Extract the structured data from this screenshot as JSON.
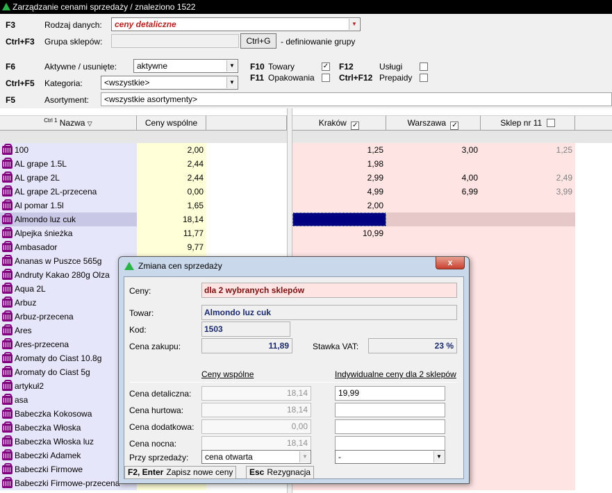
{
  "window": {
    "title": "Zarządzanie cenami sprzedaży / znaleziono 1522"
  },
  "filters": {
    "data_type": {
      "hotkey": "F3",
      "label": "Rodzaj danych:",
      "value": "ceny detaliczne"
    },
    "store_group": {
      "hotkey": "Ctrl+F3",
      "label": "Grupa sklepów:",
      "value": "",
      "button": "Ctrl+G",
      "hint": "- definiowanie grupy"
    },
    "active": {
      "hotkey": "F6",
      "label": "Aktywne / usunięte:",
      "value": "aktywne"
    },
    "category": {
      "hotkey": "Ctrl+F5",
      "label": "Kategoria:",
      "value": "<wszystkie>"
    },
    "assortment": {
      "hotkey": "F5",
      "label": "Asortyment:",
      "value": "<wszystkie asortymenty>"
    },
    "types": [
      {
        "hotkey": "F10",
        "label": "Towary",
        "checked": true,
        "mark": "✓"
      },
      {
        "hotkey": "F11",
        "label": "Opakowania",
        "checked": false,
        "mark": ""
      },
      {
        "hotkey": "F12",
        "label": "Usługi",
        "checked": false,
        "mark": ""
      },
      {
        "hotkey": "Ctrl+F12",
        "label": "Prepaidy",
        "checked": false,
        "mark": ""
      }
    ]
  },
  "grid": {
    "columns": {
      "sort_hint": "Ctrl 1",
      "name": "Nazwa",
      "common": "Ceny wspólne",
      "stores": [
        {
          "name": "Kraków",
          "mark": "✓"
        },
        {
          "name": "Warszawa",
          "mark": "✓"
        },
        {
          "name": "Sklep nr 11",
          "mark": ""
        }
      ]
    },
    "rows": [
      {
        "name": "100",
        "common": "2,00",
        "k": "1,25",
        "w": "3,00",
        "s": "1,25"
      },
      {
        "name": "AL grape 1.5L",
        "common": "2,44",
        "k": "1,98",
        "w": "",
        "s": ""
      },
      {
        "name": "AL grape 2L",
        "common": "2,44",
        "k": "2,99",
        "w": "4,00",
        "s": "2,49"
      },
      {
        "name": "AL grape 2L-przecena",
        "common": "0,00",
        "k": "4,99",
        "w": "6,99",
        "s": "3,99"
      },
      {
        "name": "Al pomar 1.5l",
        "common": "1,65",
        "k": "2,00",
        "w": "",
        "s": ""
      },
      {
        "name": "Almondo luz cuk",
        "common": "18,14",
        "k": "",
        "w": "",
        "s": ""
      },
      {
        "name": "Alpejka śnieżka",
        "common": "11,77",
        "k": "10,99",
        "w": "",
        "s": ""
      },
      {
        "name": "Ambasador",
        "common": "9,77",
        "k": "",
        "w": "",
        "s": ""
      },
      {
        "name": "Ananas w Puszce 565g",
        "common": "",
        "k": "",
        "w": "",
        "s": ""
      },
      {
        "name": "Andruty Kakao 280g Olza",
        "common": "",
        "k": "",
        "w": "",
        "s": ""
      },
      {
        "name": "Aqua 2L",
        "common": "",
        "k": "",
        "w": "",
        "s": ""
      },
      {
        "name": "Arbuz",
        "common": "",
        "k": "",
        "w": "",
        "s": ""
      },
      {
        "name": "Arbuz-przecena",
        "common": "",
        "k": "",
        "w": "",
        "s": ""
      },
      {
        "name": "Ares",
        "common": "",
        "k": "",
        "w": "",
        "s": ""
      },
      {
        "name": "Ares-przecena",
        "common": "",
        "k": "",
        "w": "",
        "s": ""
      },
      {
        "name": "Aromaty do Ciast 10.8g",
        "common": "",
        "k": "",
        "w": "",
        "s": ""
      },
      {
        "name": "Aromaty do Ciast 5g",
        "common": "",
        "k": "",
        "w": "",
        "s": ""
      },
      {
        "name": "artykuł2",
        "common": "",
        "k": "",
        "w": "",
        "s": ""
      },
      {
        "name": "asa",
        "common": "",
        "k": "",
        "w": "",
        "s": ""
      },
      {
        "name": "Babeczka Kokosowa",
        "common": "",
        "k": "",
        "w": "",
        "s": ""
      },
      {
        "name": "Babeczka Włoska",
        "common": "",
        "k": "",
        "w": "",
        "s": ""
      },
      {
        "name": "Babeczka Włoska luz",
        "common": "",
        "k": "",
        "w": "",
        "s": ""
      },
      {
        "name": "Babeczki Adamek",
        "common": "",
        "k": "",
        "w": "",
        "s": ""
      },
      {
        "name": "Babeczki Firmowe",
        "common": "",
        "k": "",
        "w": "",
        "s": ""
      },
      {
        "name": "Babeczki Firmowe-przecena",
        "common": "",
        "k": "",
        "w": "",
        "s": ""
      }
    ]
  },
  "dialog": {
    "title": "Zmiana cen sprzedaży",
    "close": "x",
    "prices_label": "Ceny:",
    "prices_value": "dla 2 wybranych sklepów",
    "product_label": "Towar:",
    "product_value": "Almondo luz cuk",
    "code_label": "Kod:",
    "code_value": "1503",
    "purchase_label": "Cena zakupu:",
    "purchase_value": "11,89",
    "vat_label": "Stawka VAT:",
    "vat_value": "23 %",
    "common_header": "Ceny wspólne",
    "individual_header": "Indywidualne ceny dla 2 sklepów",
    "price_rows": [
      {
        "label": "Cena detaliczna:",
        "common": "18,14",
        "individual": "19,99"
      },
      {
        "label": "Cena hurtowa:",
        "common": "18,14",
        "individual": ""
      },
      {
        "label": "Cena dodatkowa:",
        "common": "0,00",
        "individual": ""
      },
      {
        "label": "Cena nocna:",
        "common": "18,14",
        "individual": ""
      }
    ],
    "sale_label": "Przy sprzedaży:",
    "sale_common": "cena otwarta",
    "sale_individual": "-",
    "save": {
      "key": "F2, Enter",
      "label": "Zapisz nowe ceny"
    },
    "cancel": {
      "key": "Esc",
      "label": "Rezygnacja"
    }
  }
}
